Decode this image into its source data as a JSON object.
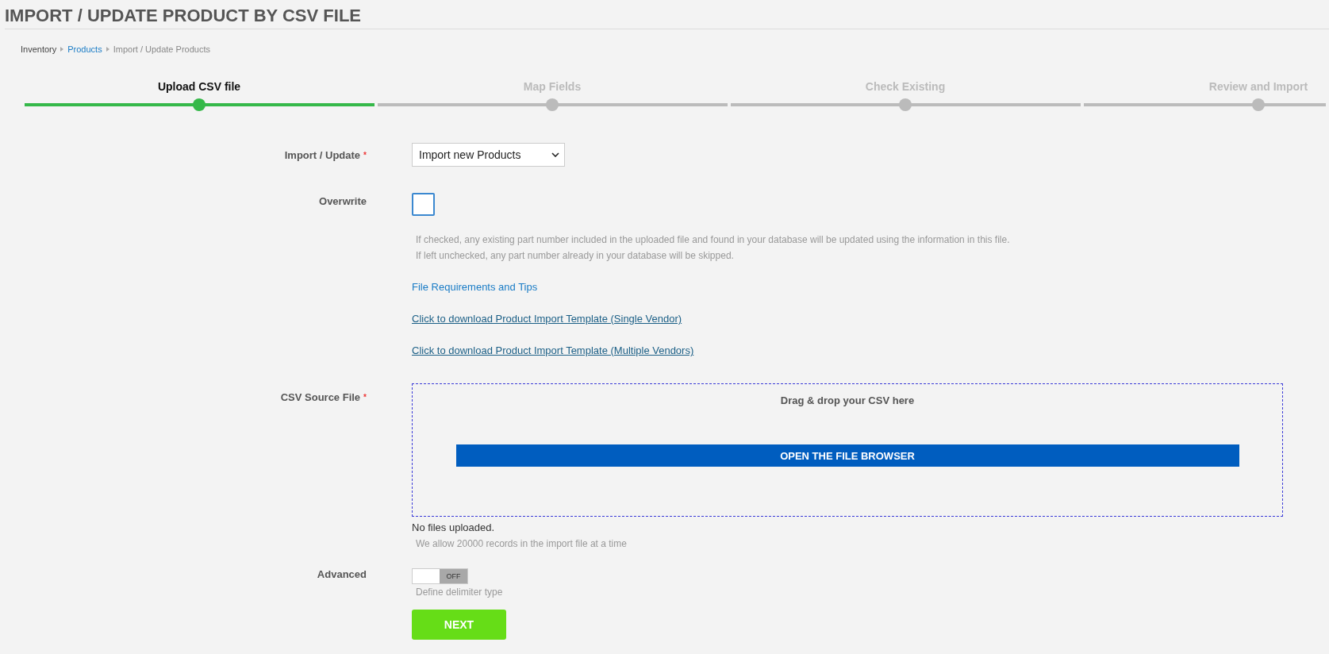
{
  "page_title": "IMPORT / UPDATE PRODUCT BY CSV FILE",
  "breadcrumb": [
    {
      "label": "Inventory",
      "kind": "plain"
    },
    {
      "label": "Products",
      "kind": "link"
    },
    {
      "label": "Import / Update Products",
      "kind": "current"
    }
  ],
  "steps": [
    {
      "label": "Upload CSV file",
      "active": true
    },
    {
      "label": "Map Fields",
      "active": false
    },
    {
      "label": "Check Existing",
      "active": false
    },
    {
      "label": "Review and Import",
      "active": false
    }
  ],
  "form": {
    "import_update": {
      "label": "Import / Update",
      "required_mark": "*",
      "value": "Import new Products"
    },
    "overwrite": {
      "label": "Overwrite",
      "checked": false,
      "help": [
        "If checked, any existing part number included in the uploaded file and found in your database will be updated using the information in this file.",
        "If left unchecked, any part number already in your database will be skipped."
      ]
    },
    "tips_link": "File Requirements and Tips",
    "template_links": [
      "Click to download Product Import Template (Single Vendor)",
      "Click to download Product Import Template (Multiple Vendors)"
    ],
    "csv_source": {
      "label": "CSV Source File",
      "required_mark": "*",
      "drop_text": "Drag & drop your CSV here",
      "browse_button": "OPEN THE FILE BROWSER",
      "status": "No files uploaded.",
      "note": "We allow 20000 records in the import file at a time"
    },
    "advanced": {
      "label": "Advanced",
      "on": false,
      "switch_text": "OFF",
      "hint": "Define delimiter type"
    },
    "next_button": "NEXT"
  }
}
